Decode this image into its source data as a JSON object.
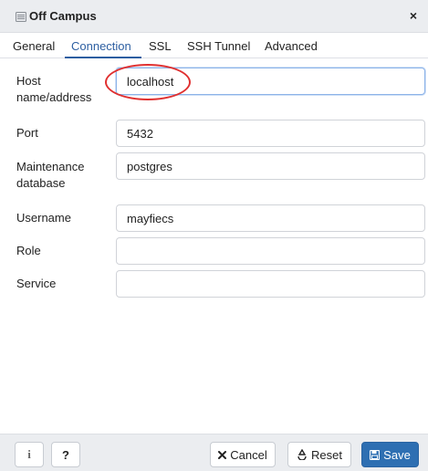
{
  "dialog": {
    "title": "Off Campus",
    "close_glyph": "×"
  },
  "tabs": [
    {
      "label": "General",
      "active": false
    },
    {
      "label": "Connection",
      "active": true
    },
    {
      "label": "SSL",
      "active": false
    },
    {
      "label": "SSH Tunnel",
      "active": false
    },
    {
      "label": "Advanced",
      "active": false
    }
  ],
  "form": {
    "host": {
      "label": "Host name/address",
      "label_line1": "Host",
      "label_line2": "name/address",
      "value": "localhost"
    },
    "port": {
      "label": "Port",
      "value": "5432"
    },
    "maintenance_db": {
      "label": "Maintenance database",
      "label_line1": "Maintenance",
      "label_line2": "database",
      "value": "postgres"
    },
    "username": {
      "label": "Username",
      "value": "mayfiecs"
    },
    "role": {
      "label": "Role",
      "value": ""
    },
    "service": {
      "label": "Service",
      "value": ""
    }
  },
  "footer": {
    "info_glyph": "i",
    "help_glyph": "?",
    "cancel_label": "Cancel",
    "reset_label": "Reset",
    "save_label": "Save"
  },
  "colors": {
    "accent": "#2c5ea1",
    "save_button": "#2e6fb2",
    "highlight": "#e03030"
  },
  "icons": {
    "title": "server-icon",
    "close": "close-icon",
    "cancel": "x-icon",
    "reset": "recycle-icon",
    "save": "floppy-disk-icon"
  }
}
